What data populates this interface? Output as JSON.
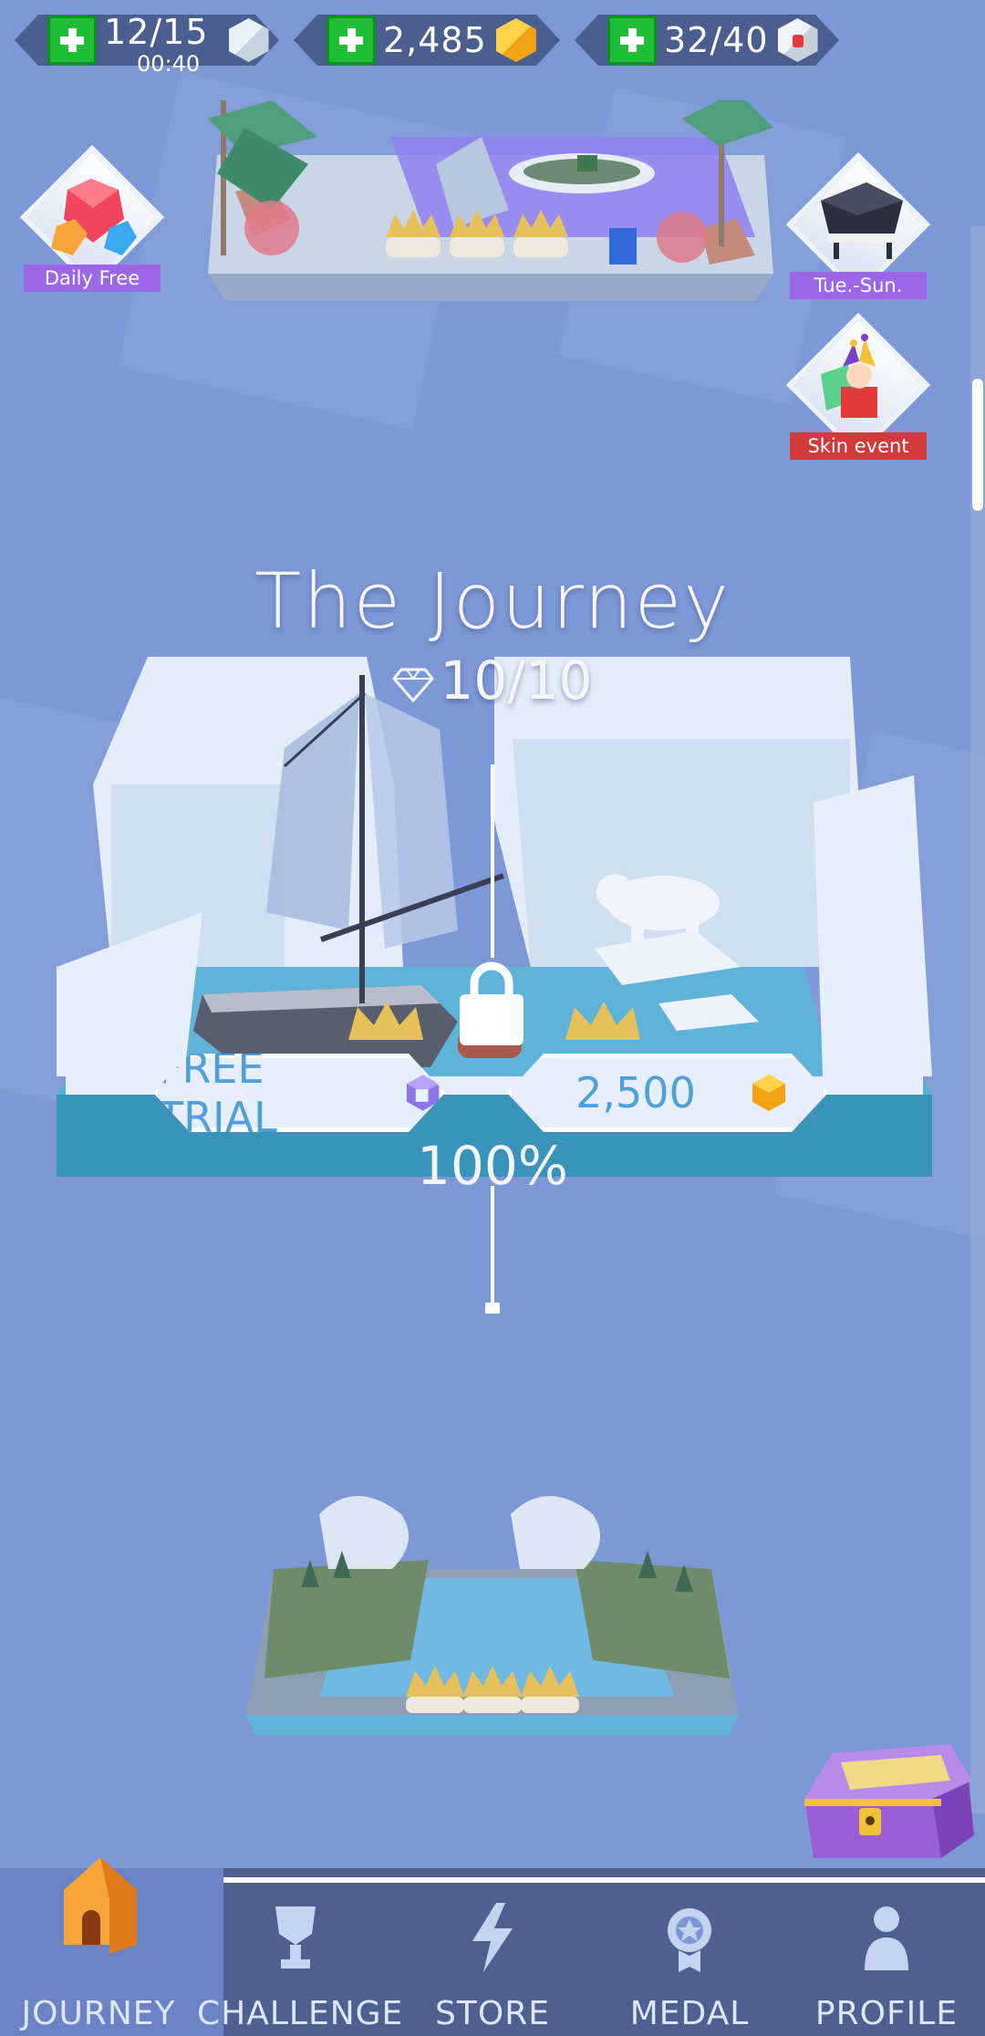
{
  "resources": {
    "energy": {
      "value": "12/15",
      "timer": "00:40",
      "icon": "white-cube-icon"
    },
    "coins": {
      "value": "2,485",
      "icon": "gold-cube-icon"
    },
    "tickets": {
      "value": "32/40",
      "icon": "ticket-cube-icon"
    }
  },
  "events": {
    "daily_free": "Daily Free",
    "piano": "Tue.-Sun.",
    "skin_event": "Skin event"
  },
  "level": {
    "title": "The Journey",
    "gems": "10/10",
    "free_trial": "FREE TRIAL",
    "price": "2,500",
    "progress": "100%"
  },
  "nav": {
    "journey": "JOURNEY",
    "challenge": "CHALLENGE",
    "store": "STORE",
    "medal": "MEDAL",
    "profile": "PROFILE"
  },
  "colors": {
    "background": "#7d98d6",
    "nav": "#4f5f8f",
    "accent_blue": "#4f9fd8",
    "gold": "#f0a414",
    "green_plus": "#1fbf35"
  }
}
